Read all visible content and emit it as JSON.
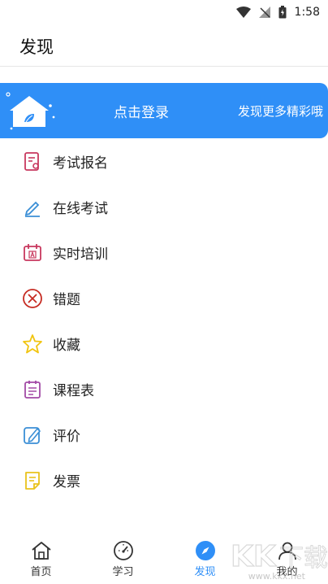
{
  "status_bar": {
    "time": "1:58"
  },
  "header": {
    "title": "发现"
  },
  "banner": {
    "login_text": "点击登录",
    "more_text": "发现更多精彩哦"
  },
  "menu": {
    "items": [
      {
        "label": "考试报名",
        "icon": "exam-register-icon",
        "color": "#c8385e"
      },
      {
        "label": "在线考试",
        "icon": "pen-icon",
        "color": "#3b8fd6"
      },
      {
        "label": "实时培训",
        "icon": "calendar-icon",
        "color": "#c8385e"
      },
      {
        "label": "错题",
        "icon": "close-circle-icon",
        "color": "#c62b22"
      },
      {
        "label": "收藏",
        "icon": "star-icon",
        "color": "#f1c40f"
      },
      {
        "label": "课程表",
        "icon": "schedule-icon",
        "color": "#a24aa6"
      },
      {
        "label": "评价",
        "icon": "edit-icon",
        "color": "#3b8fd6"
      },
      {
        "label": "发票",
        "icon": "invoice-icon",
        "color": "#e9c21b"
      }
    ]
  },
  "bottom_nav": {
    "items": [
      {
        "label": "首页",
        "icon": "home-icon"
      },
      {
        "label": "学习",
        "icon": "gauge-icon"
      },
      {
        "label": "发现",
        "icon": "compass-icon",
        "active": true
      },
      {
        "label": "我的",
        "icon": "user-icon"
      }
    ]
  },
  "watermark": {
    "text": "www.kkx.net"
  },
  "colors": {
    "accent": "#2f8ff7"
  }
}
